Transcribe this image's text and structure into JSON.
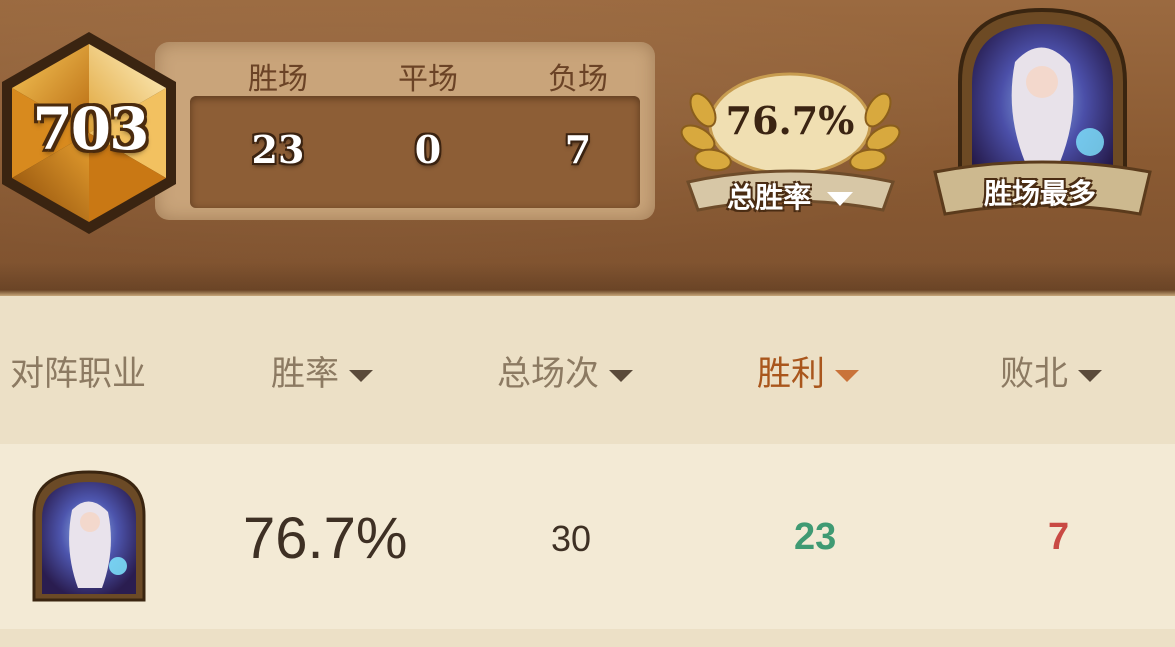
{
  "summary": {
    "rank": "703",
    "stats": [
      {
        "label": "胜场",
        "value": "23"
      },
      {
        "label": "平场",
        "value": "0"
      },
      {
        "label": "负场",
        "value": "7"
      }
    ],
    "win_rate": "76.7%",
    "win_rate_label": "总胜率",
    "most_wins_label": "胜场最多",
    "most_wins_hero_icon": "mage-hero-portrait"
  },
  "table": {
    "columns": [
      "对阵职业",
      "胜率",
      "总场次",
      "胜利",
      "败北"
    ],
    "active_sort_column": "胜利",
    "rows": [
      {
        "class_icon": "mage-hero-portrait",
        "win_rate": "76.7%",
        "total": "30",
        "wins": "23",
        "losses": "7"
      }
    ]
  },
  "colors": {
    "banner": "#8a5a32",
    "active_header": "#a9561c",
    "wins": "#3f9a73",
    "losses": "#c94a44"
  }
}
